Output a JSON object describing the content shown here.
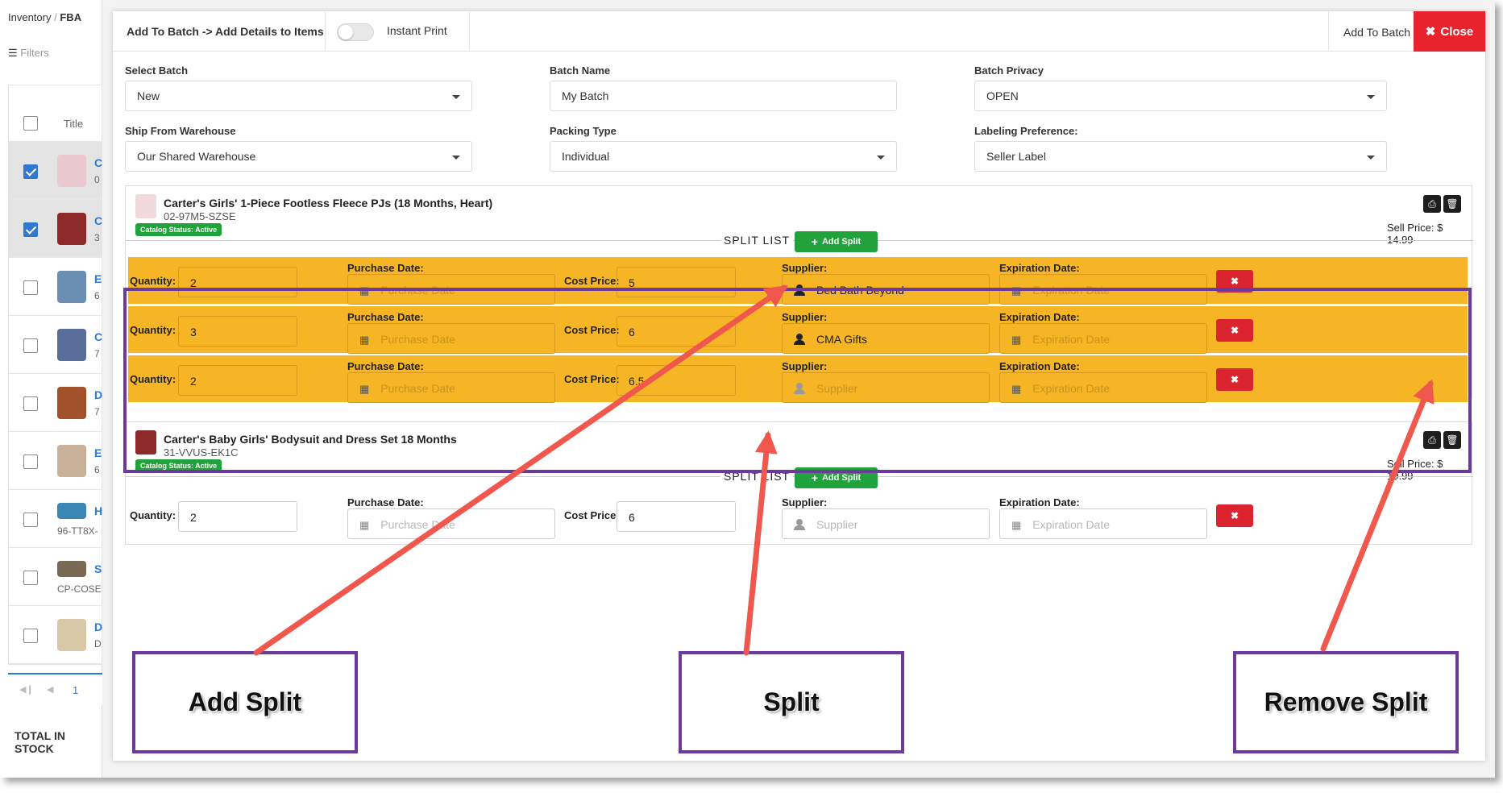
{
  "background": {
    "breadcrumb_parent": "Inventory",
    "breadcrumb_sep": "/",
    "breadcrumb_current": "FBA",
    "filters_label": "Filters",
    "title_header": "Title",
    "rows": [
      {
        "link": "C",
        "sub": "0",
        "selected": true
      },
      {
        "link": "C",
        "sub": "3",
        "selected": true
      },
      {
        "link": "E",
        "sub": "6",
        "selected": false
      },
      {
        "link": "C",
        "sub": "7",
        "selected": false
      },
      {
        "link": "D",
        "sub": "7",
        "selected": false
      },
      {
        "link": "E",
        "sub": "6",
        "selected": false
      },
      {
        "link": "H",
        "sub": "96-TT8X-",
        "selected": false
      },
      {
        "link": "S",
        "sub": "CP-COSE",
        "selected": false
      },
      {
        "link": "D",
        "sub": "D",
        "selected": false
      }
    ],
    "page_number": "1",
    "total_label": "TOTAL IN STOCK"
  },
  "modal": {
    "title": "Add To Batch -> Add Details to Items",
    "instant_print_label": "Instant Print",
    "add_to_batch_label": "Add To Batch",
    "close_label": "Close",
    "fields": {
      "select_batch_label": "Select Batch",
      "select_batch_value": "New",
      "batch_name_label": "Batch Name",
      "batch_name_value": "My Batch",
      "batch_privacy_label": "Batch Privacy",
      "batch_privacy_value": "OPEN",
      "ship_from_label": "Ship From Warehouse",
      "ship_from_value": "Our Shared Warehouse",
      "packing_type_label": "Packing Type",
      "packing_type_value": "Individual",
      "labeling_label": "Labeling Preference:",
      "labeling_value": "Seller Label"
    },
    "labels": {
      "quantity": "Quantity:",
      "purchase_date": "Purchase Date:",
      "cost_price": "Cost Price:",
      "supplier": "Supplier:",
      "expiration_date": "Expiration Date:",
      "purchase_date_ph": "Purchase Date",
      "supplier_ph": "Supplier",
      "expiration_date_ph": "Expiration Date",
      "split_list": "SPLIT LIST",
      "add_split": "Add Split"
    },
    "products": [
      {
        "name": "Carter's Girls' 1-Piece Footless Fleece PJs (18 Months, Heart)",
        "sku": "02-97M5-SZSE",
        "status": "Catalog Status: Active",
        "sell_price": "Sell Price: $ 14.99",
        "splits": [
          {
            "quantity": "2",
            "cost": "5",
            "supplier": "Bed Bath Beyond"
          },
          {
            "quantity": "3",
            "cost": "6",
            "supplier": "CMA Gifts"
          },
          {
            "quantity": "2",
            "cost": "6.5",
            "supplier": ""
          }
        ]
      },
      {
        "name": "Carter's Baby Girls' Bodysuit and Dress Set 18 Months",
        "sku": "31-VVUS-EK1C",
        "status": "Catalog Status: Active",
        "sell_price": "Sell Price: $ 19.99",
        "splits": [
          {
            "quantity": "2",
            "cost": "6",
            "supplier": ""
          }
        ]
      }
    ]
  },
  "callouts": {
    "add_split": "Add Split",
    "split": "Split",
    "remove_split": "Remove Split"
  },
  "colors": {
    "highlight": "#f6b524",
    "annotation": "#6b3a9b",
    "arrow": "#f0584e",
    "close": "#e8232b",
    "success": "#22a23a"
  }
}
